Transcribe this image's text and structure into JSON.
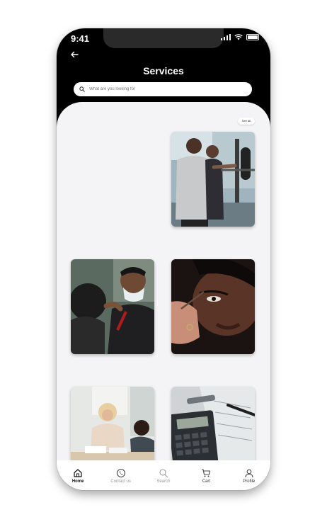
{
  "status": {
    "time": "9:41"
  },
  "header": {
    "title": "Services"
  },
  "search": {
    "placeholder": "What are you looking for"
  },
  "section": {
    "see_all_label": "See all"
  },
  "tabs": [
    {
      "label": "Home",
      "icon": "home-icon"
    },
    {
      "label": "Contact us",
      "icon": "phone-icon"
    },
    {
      "label": "Search",
      "icon": "search-icon"
    },
    {
      "label": "Cart",
      "icon": "cart-icon"
    },
    {
      "label": "Profile",
      "icon": "profile-icon"
    }
  ],
  "colors": {
    "header": "#000000",
    "background": "#f4f4f6",
    "active_tab": "#111111",
    "inactive_tab": "#9a9a9a"
  }
}
